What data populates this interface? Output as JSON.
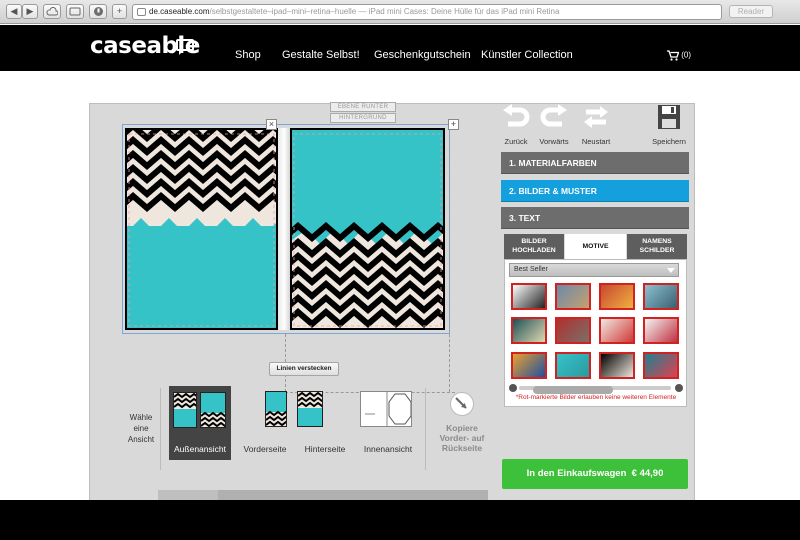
{
  "browser": {
    "url_domain": "de.caseable.com",
    "url_path": "/selbstgestaltete–ipad–mini–retina–huelle",
    "page_title": "iPad mini Cases: Deine Hülle für das iPad mini Retina",
    "url_separator": " — ",
    "reader_label": "Reader",
    "back_label": "◀",
    "forward_label": "▶",
    "new_tab_label": "+"
  },
  "header": {
    "logo_text": "caseable",
    "nav": [
      "Shop",
      "Gestalte Selbst!",
      "Geschenkgutschein",
      "Künstler Collection"
    ],
    "cart_count": "(0)"
  },
  "canvas": {
    "layer_down_label": "EBENE RUNTER",
    "layer_back_label": "HINTERGRUND",
    "hide_lines_label": "Linien verstecken",
    "colors": {
      "turquoise": "#35c3c8",
      "chevron_dark": "#000000",
      "chevron_light": "#efe6dd"
    }
  },
  "views": {
    "prompt": "Wähle eine Ansicht",
    "items": [
      {
        "label": "Außenansicht",
        "active": true
      },
      {
        "label": "Vorderseite",
        "active": false
      },
      {
        "label": "Hinterseite",
        "active": false
      },
      {
        "label": "Innenansicht",
        "active": false
      }
    ],
    "copy_label": "Kopiere Vorder- auf Rückseite"
  },
  "toolbar": {
    "undo_label": "Zurück",
    "redo_label": "Vorwärts",
    "restart_label": "Neustart",
    "save_label": "Speichern"
  },
  "steps": [
    {
      "label": "1. MATERIALFARBEN",
      "active": false
    },
    {
      "label": "2. BILDER & MUSTER",
      "active": true
    },
    {
      "label": "3. TEXT",
      "active": false
    }
  ],
  "tabs": [
    {
      "label": "BILDER HOCHLADEN",
      "active": false
    },
    {
      "label": "MOTIVE",
      "active": true
    },
    {
      "label": "NAMENS SCHILDER",
      "active": false
    }
  ],
  "gallery": {
    "dropdown_value": "Best Seller",
    "note": "*Rot-markierte Bilder erlauben keine weiteren Elemente",
    "scroll_fraction": 0.2,
    "thumbnails": [
      {
        "icon": "cassette-image",
        "colors": [
          "#ffffff",
          "#222222"
        ]
      },
      {
        "icon": "bicycle-image",
        "colors": [
          "#6a8aa8",
          "#c8a070"
        ]
      },
      {
        "icon": "ferris-wheel-image",
        "colors": [
          "#c84830",
          "#f0b040"
        ]
      },
      {
        "icon": "tree-image",
        "colors": [
          "#8cc0d0",
          "#3a6070"
        ]
      },
      {
        "icon": "flower-image",
        "colors": [
          "#1e5058",
          "#e0d8b0"
        ]
      },
      {
        "icon": "phone-booth-image",
        "colors": [
          "#b03030",
          "#7a7068"
        ]
      },
      {
        "icon": "floral-skull-image",
        "colors": [
          "#f0e8e0",
          "#d03838"
        ]
      },
      {
        "icon": "flowers-white-image",
        "colors": [
          "#f4f4f4",
          "#c03040"
        ]
      },
      {
        "icon": "graffiti-image",
        "colors": [
          "#e8a030",
          "#2050a0"
        ]
      },
      {
        "icon": "turquoise-image",
        "colors": [
          "#35c3c8",
          "#2a9aa0"
        ]
      },
      {
        "icon": "chevron-image",
        "colors": [
          "#000000",
          "#efe6dd"
        ]
      },
      {
        "icon": "aztec-image",
        "colors": [
          "#208090",
          "#e04050"
        ]
      }
    ]
  },
  "buy": {
    "label": "In den Einkaufswagen",
    "price": "€ 44,90",
    "color": "#3ec13a"
  }
}
